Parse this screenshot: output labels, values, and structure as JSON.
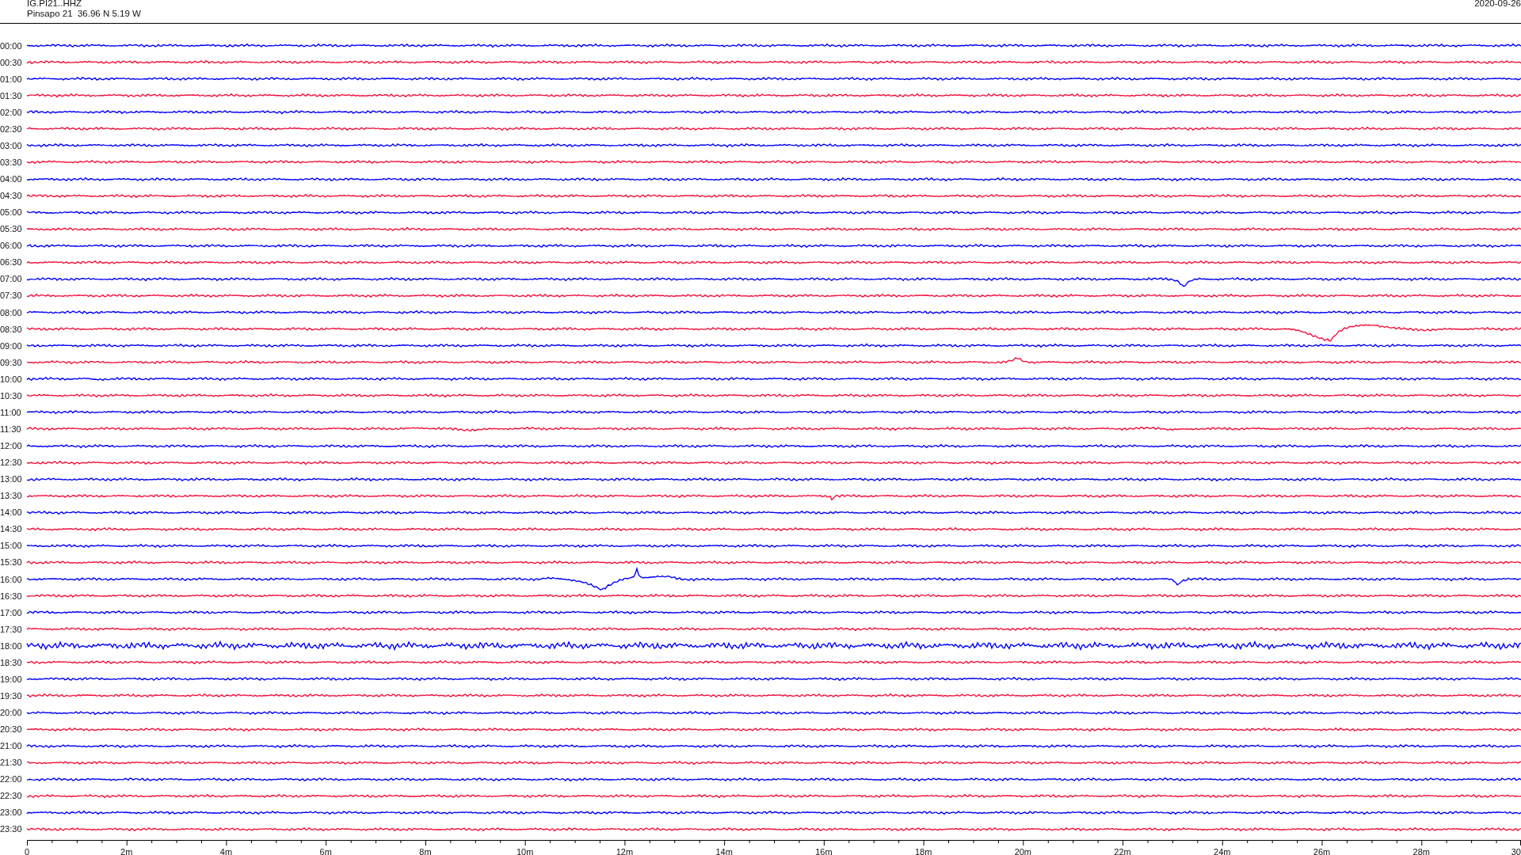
{
  "header": {
    "station": "IG.PI21..HHZ",
    "location": "Pinsapo 21  36.96 N 5.19 W",
    "date": "2020-09-26"
  },
  "traces": [
    {
      "time": "00:00",
      "color": "#0000ff"
    },
    {
      "time": "00:30",
      "color": "#f5103c"
    },
    {
      "time": "01:00",
      "color": "#0000ff"
    },
    {
      "time": "01:30",
      "color": "#f5103c"
    },
    {
      "time": "02:00",
      "color": "#0000ff"
    },
    {
      "time": "02:30",
      "color": "#f5103c"
    },
    {
      "time": "03:00",
      "color": "#0000ff"
    },
    {
      "time": "03:30",
      "color": "#f5103c"
    },
    {
      "time": "04:00",
      "color": "#0000ff"
    },
    {
      "time": "04:30",
      "color": "#f5103c"
    },
    {
      "time": "05:00",
      "color": "#0000ff"
    },
    {
      "time": "05:30",
      "color": "#f5103c"
    },
    {
      "time": "06:00",
      "color": "#0000ff"
    },
    {
      "time": "06:30",
      "color": "#f5103c"
    },
    {
      "time": "07:00",
      "color": "#0000ff"
    },
    {
      "time": "07:30",
      "color": "#f5103c"
    },
    {
      "time": "08:00",
      "color": "#0000ff"
    },
    {
      "time": "08:30",
      "color": "#f5103c"
    },
    {
      "time": "09:00",
      "color": "#0000ff"
    },
    {
      "time": "09:30",
      "color": "#f5103c"
    },
    {
      "time": "10:00",
      "color": "#0000ff"
    },
    {
      "time": "10:30",
      "color": "#f5103c"
    },
    {
      "time": "11:00",
      "color": "#0000ff"
    },
    {
      "time": "11:30",
      "color": "#f5103c"
    },
    {
      "time": "12:00",
      "color": "#0000ff"
    },
    {
      "time": "12:30",
      "color": "#f5103c"
    },
    {
      "time": "13:00",
      "color": "#0000ff"
    },
    {
      "time": "13:30",
      "color": "#f5103c"
    },
    {
      "time": "14:00",
      "color": "#0000ff"
    },
    {
      "time": "14:30",
      "color": "#f5103c"
    },
    {
      "time": "15:00",
      "color": "#0000ff"
    },
    {
      "time": "15:30",
      "color": "#f5103c"
    },
    {
      "time": "16:00",
      "color": "#0000ff"
    },
    {
      "time": "16:30",
      "color": "#f5103c"
    },
    {
      "time": "17:00",
      "color": "#0000ff"
    },
    {
      "time": "17:30",
      "color": "#f5103c"
    },
    {
      "time": "18:00",
      "color": "#0000ff"
    },
    {
      "time": "18:30",
      "color": "#f5103c"
    },
    {
      "time": "19:00",
      "color": "#0000ff"
    },
    {
      "time": "19:30",
      "color": "#f5103c"
    },
    {
      "time": "20:00",
      "color": "#0000ff"
    },
    {
      "time": "20:30",
      "color": "#f5103c"
    },
    {
      "time": "21:00",
      "color": "#0000ff"
    },
    {
      "time": "21:30",
      "color": "#f5103c"
    },
    {
      "time": "22:00",
      "color": "#0000ff"
    },
    {
      "time": "22:30",
      "color": "#f5103c"
    },
    {
      "time": "23:00",
      "color": "#0000ff"
    },
    {
      "time": "23:30",
      "color": "#f5103c"
    }
  ],
  "axis": {
    "ticks": [
      "0",
      "2m",
      "4m",
      "6m",
      "8m",
      "10m",
      "12m",
      "14m",
      "16m",
      "18m",
      "20m",
      "22m",
      "24m",
      "26m",
      "28m",
      "30"
    ]
  }
}
